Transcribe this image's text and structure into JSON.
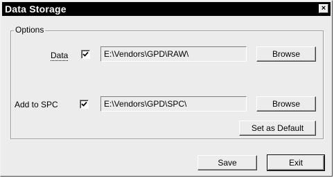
{
  "window": {
    "title": "Data Storage",
    "close_glyph": "×"
  },
  "group": {
    "label": "Options"
  },
  "rows": [
    {
      "label": "Data",
      "checked": true,
      "path": "E:\\Vendors\\GPD\\RAW\\",
      "button": "Browse"
    },
    {
      "label": "Add to SPC",
      "checked": true,
      "path": "E:\\Vendors\\GPD\\SPC\\",
      "button": "Browse"
    }
  ],
  "buttons": {
    "set_default": "Set as Default",
    "save": "Save",
    "exit": "Exit"
  },
  "colors": {
    "face": "#ececec",
    "title_bar": "#000000"
  }
}
